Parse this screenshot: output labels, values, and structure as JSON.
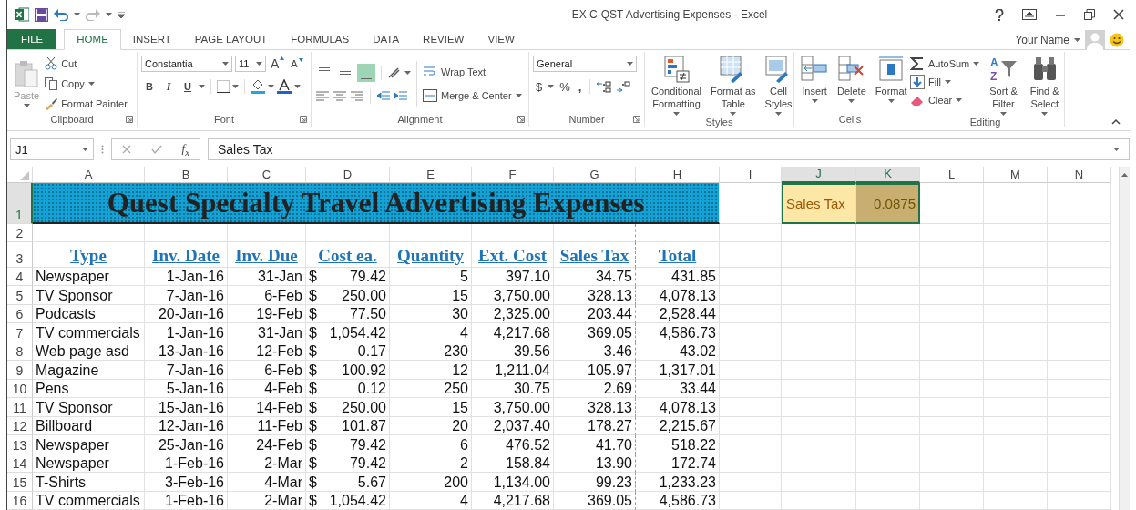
{
  "window": {
    "title": "EX C-QST Advertising Expenses - Excel"
  },
  "ribbon": {
    "tabs": [
      {
        "label": "FILE",
        "kind": "file",
        "selected": false
      },
      {
        "label": "HOME",
        "kind": "tab",
        "selected": true
      },
      {
        "label": "INSERT",
        "kind": "tab",
        "selected": false
      },
      {
        "label": "PAGE LAYOUT",
        "kind": "tab",
        "selected": false
      },
      {
        "label": "FORMULAS",
        "kind": "tab",
        "selected": false
      },
      {
        "label": "DATA",
        "kind": "tab",
        "selected": false
      },
      {
        "label": "REVIEW",
        "kind": "tab",
        "selected": false
      },
      {
        "label": "VIEW",
        "kind": "tab",
        "selected": false
      }
    ],
    "user": "Your Name",
    "groups": [
      {
        "kind": "clipboard",
        "label": "Clipboard",
        "paste": "Paste",
        "small": [
          "Cut",
          "Copy",
          "Format Painter"
        ]
      },
      {
        "kind": "font",
        "label": "Font",
        "font_name": "Constantia",
        "font_size": "11",
        "size_buttons": [
          "A",
          "A"
        ],
        "styles": [
          "B",
          "I",
          "U"
        ]
      },
      {
        "kind": "alignment",
        "label": "Alignment",
        "vertical_align": [
          {
            "selected": false
          },
          {
            "selected": false
          },
          {
            "selected": true
          }
        ],
        "small": [
          "Wrap Text",
          "Merge & Center"
        ]
      },
      {
        "kind": "number",
        "label": "Number",
        "format": "General",
        "symbols": [
          "$",
          "%",
          ","
        ]
      },
      {
        "kind": "styles",
        "label": "Styles",
        "large": [
          {
            "lines": [
              "Conditional",
              "Formatting"
            ]
          },
          {
            "lines": [
              "Format as",
              "Table"
            ]
          },
          {
            "lines": [
              "Cell",
              "Styles"
            ]
          }
        ]
      },
      {
        "kind": "cells",
        "label": "Cells",
        "large": [
          {
            "lines": [
              "Insert"
            ]
          },
          {
            "lines": [
              "Delete"
            ]
          },
          {
            "lines": [
              "Format"
            ]
          }
        ]
      },
      {
        "kind": "editing",
        "label": "Editing",
        "small": [
          "AutoSum",
          "Fill",
          "Clear"
        ],
        "sort_letters": [
          "A",
          "Z"
        ],
        "large": [
          {
            "lines": [
              "Sort &",
              "Filter"
            ]
          },
          {
            "lines": [
              "Find &",
              "Select"
            ]
          }
        ]
      }
    ]
  },
  "formula_bar": {
    "name_box": "J1",
    "function_button": "f$_{x}$",
    "formula": "Sales Tax"
  },
  "sheet": {
    "column_headers": [
      {
        "label": "A",
        "selected": false
      },
      {
        "label": "B",
        "selected": false
      },
      {
        "label": "C",
        "selected": false
      },
      {
        "label": "D",
        "selected": false
      },
      {
        "label": "E",
        "selected": false
      },
      {
        "label": "F",
        "selected": false
      },
      {
        "label": "G",
        "selected": false
      },
      {
        "label": "H",
        "selected": false
      },
      {
        "label": "I",
        "selected": false
      },
      {
        "label": "J",
        "selected": true
      },
      {
        "label": "K",
        "selected": true
      },
      {
        "label": "L",
        "selected": false
      },
      {
        "label": "M",
        "selected": false
      },
      {
        "label": "N",
        "selected": false
      }
    ],
    "row_headers": [
      {
        "label": "1",
        "selected": true
      },
      {
        "label": "2",
        "selected": false
      },
      {
        "label": "3",
        "selected": false
      },
      {
        "label": "4",
        "selected": false
      },
      {
        "label": "5",
        "selected": false
      },
      {
        "label": "6",
        "selected": false
      },
      {
        "label": "7",
        "selected": false
      },
      {
        "label": "8",
        "selected": false
      },
      {
        "label": "9",
        "selected": false
      },
      {
        "label": "10",
        "selected": false
      },
      {
        "label": "11",
        "selected": false
      },
      {
        "label": "12",
        "selected": false
      },
      {
        "label": "13",
        "selected": false
      },
      {
        "label": "14",
        "selected": false
      },
      {
        "label": "15",
        "selected": false
      },
      {
        "label": "16",
        "selected": false
      }
    ],
    "title": "Quest Specialty Travel Advertising Expenses",
    "tax_label": "Sales Tax",
    "tax_rate": "0.0875",
    "headers": [
      "Type",
      "Inv. Date",
      "Inv. Due",
      "Cost ea.",
      "Quantity",
      "Ext. Cost",
      "Sales Tax",
      "Total"
    ],
    "rows": [
      [
        "Newspaper",
        "1-Jan-16",
        "31-Jan",
        {
          "currency": "$",
          "amount": "79.42"
        },
        "5",
        "397.10",
        "34.75",
        "431.85"
      ],
      [
        "TV Sponsor",
        "7-Jan-16",
        "6-Feb",
        {
          "currency": "$",
          "amount": "250.00"
        },
        "15",
        "3,750.00",
        "328.13",
        "4,078.13"
      ],
      [
        "Podcasts",
        "20-Jan-16",
        "19-Feb",
        {
          "currency": "$",
          "amount": "77.50"
        },
        "30",
        "2,325.00",
        "203.44",
        "2,528.44"
      ],
      [
        "TV commercials",
        "1-Jan-16",
        "31-Jan",
        {
          "currency": "$",
          "amount": "1,054.42"
        },
        "4",
        "4,217.68",
        "369.05",
        "4,586.73"
      ],
      [
        "Web page asd",
        "13-Jan-16",
        "12-Feb",
        {
          "currency": "$",
          "amount": "0.17"
        },
        "230",
        "39.56",
        "3.46",
        "43.02"
      ],
      [
        "Magazine",
        "7-Jan-16",
        "6-Feb",
        {
          "currency": "$",
          "amount": "100.92"
        },
        "12",
        "1,211.04",
        "105.97",
        "1,317.01"
      ],
      [
        "Pens",
        "5-Jan-16",
        "4-Feb",
        {
          "currency": "$",
          "amount": "0.12"
        },
        "250",
        "30.75",
        "2.69",
        "33.44"
      ],
      [
        "TV Sponsor",
        "15-Jan-16",
        "14-Feb",
        {
          "currency": "$",
          "amount": "250.00"
        },
        "15",
        "3,750.00",
        "328.13",
        "4,078.13"
      ],
      [
        "Billboard",
        "12-Jan-16",
        "11-Feb",
        {
          "currency": "$",
          "amount": "101.87"
        },
        "20",
        "2,037.40",
        "178.27",
        "2,215.67"
      ],
      [
        "Newspaper",
        "25-Jan-16",
        "24-Feb",
        {
          "currency": "$",
          "amount": "79.42"
        },
        "6",
        "476.52",
        "41.70",
        "518.22"
      ],
      [
        "Newspaper",
        "1-Feb-16",
        "2-Mar",
        {
          "currency": "$",
          "amount": "79.42"
        },
        "2",
        "158.84",
        "13.90",
        "172.74"
      ],
      [
        "T-Shirts",
        "3-Feb-16",
        "4-Mar",
        {
          "currency": "$",
          "amount": "5.67"
        },
        "200",
        "1,134.00",
        "99.23",
        "1,233.23"
      ],
      [
        "TV commercials",
        "1-Feb-16",
        "2-Mar",
        {
          "currency": "$",
          "amount": "1,054.42"
        },
        "4",
        "4,217.68",
        "369.05",
        "4,586.73"
      ]
    ]
  }
}
